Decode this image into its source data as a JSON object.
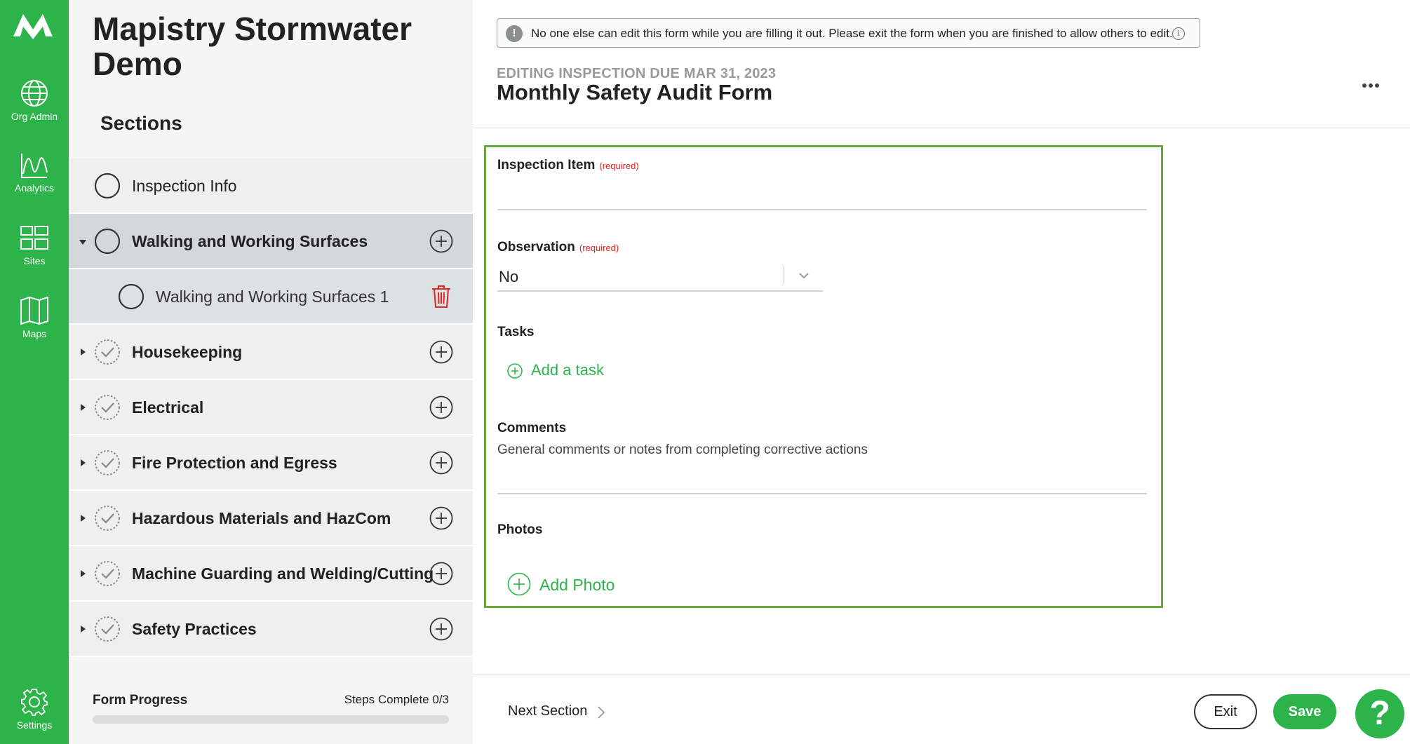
{
  "app": {
    "org_name": "Mapistry Stormwater Demo",
    "brand_color": "#2cb34a",
    "logo_icon": "mapistry-logo-icon"
  },
  "rail": {
    "items": [
      {
        "label": "Org Admin",
        "icon": "globe-icon"
      },
      {
        "label": "Analytics",
        "icon": "line-chart-icon"
      },
      {
        "label": "Sites",
        "icon": "grid-icon"
      },
      {
        "label": "Maps",
        "icon": "map-icon"
      }
    ],
    "settings": {
      "label": "Settings",
      "icon": "gear-icon"
    }
  },
  "sidebar": {
    "sections_heading": "Sections",
    "sections": [
      {
        "label": "Inspection Info",
        "status": "empty"
      },
      {
        "label": "Walking and Working Surfaces",
        "status": "empty",
        "expanded": true
      },
      {
        "label": "Walking and Working Surfaces 1",
        "status": "empty",
        "child": true
      },
      {
        "label": "Housekeeping",
        "status": "check"
      },
      {
        "label": "Electrical",
        "status": "check"
      },
      {
        "label": "Fire Protection and Egress",
        "status": "check"
      },
      {
        "label": "Hazardous Materials and HazCom",
        "status": "check"
      },
      {
        "label": "Machine Guarding and Welding/Cutting",
        "status": "check"
      },
      {
        "label": "Safety Practices",
        "status": "check"
      }
    ],
    "progress": {
      "label": "Form Progress",
      "steps_text": "Steps Complete 0/3",
      "fraction": 0
    }
  },
  "main": {
    "notice": "No one else can edit this form while you are filling it out. Please exit the form when you are finished to allow others to edit.",
    "due_label": "EDITING INSPECTION DUE MAR 31, 2023",
    "form_title": "Monthly Safety Audit Form",
    "fields": {
      "inspection_item": {
        "label": "Inspection Item",
        "required_text": "(required)",
        "value": ""
      },
      "observation": {
        "label": "Observation",
        "required_text": "(required)",
        "value": "No"
      },
      "tasks": {
        "label": "Tasks",
        "add_label": "Add a task"
      },
      "comments": {
        "label": "Comments",
        "value": "General comments or notes from completing corrective actions"
      },
      "photos": {
        "label": "Photos",
        "add_label": "Add Photo"
      }
    }
  },
  "footer": {
    "next_section": "Next Section",
    "exit_label": "Exit",
    "save_label": "Save",
    "help_label": "?"
  }
}
